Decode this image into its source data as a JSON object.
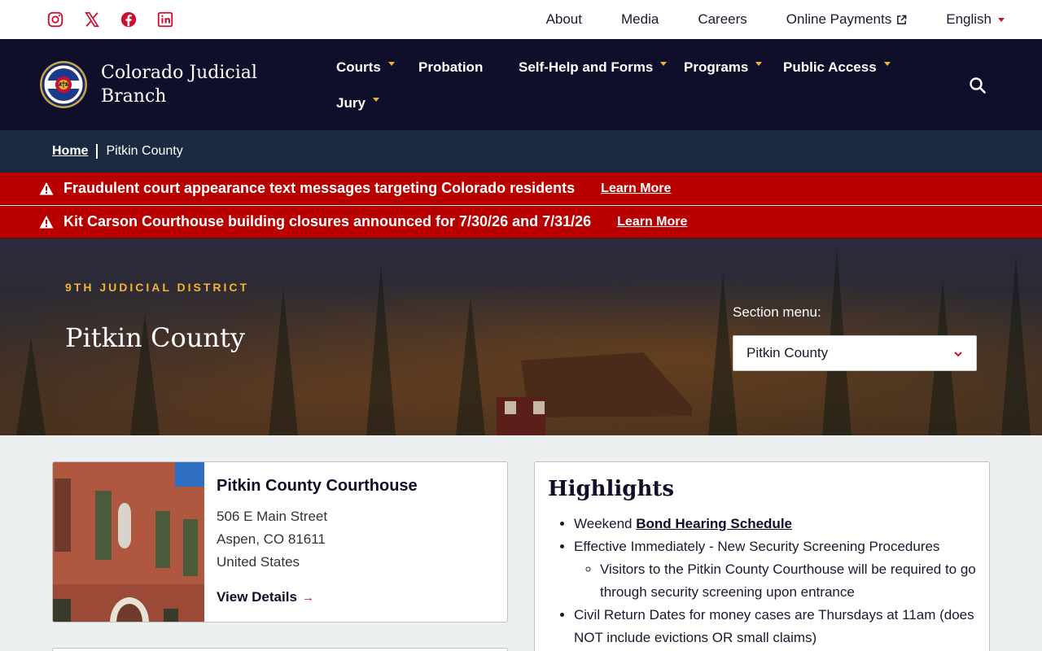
{
  "utility": {
    "social": [
      "instagram-icon",
      "x-icon",
      "facebook-icon",
      "linkedin-icon"
    ],
    "links": {
      "about": "About",
      "media": "Media",
      "careers": "Careers",
      "payments": "Online Payments",
      "language": "English"
    }
  },
  "header": {
    "brand_line1": "Colorado Judicial",
    "brand_line2": "Branch",
    "seal_text_top": "COLORADO",
    "seal_text_bottom": "COURTS",
    "nav": {
      "courts": "Courts",
      "probation": "Probation",
      "selfhelp": "Self-Help and Forms",
      "programs": "Programs",
      "public_access": "Public Access",
      "jury": "Jury"
    }
  },
  "breadcrumb": {
    "home": "Home",
    "current": "Pitkin County"
  },
  "alerts": [
    {
      "message": "Fraudulent court appearance text messages targeting Colorado residents",
      "link": "Learn More"
    },
    {
      "message": "Kit Carson Courthouse building closures announced for 7/30/26 and 7/31/26",
      "link": "Learn More"
    }
  ],
  "hero": {
    "eyebrow": "9TH JUDICIAL DISTRICT",
    "title": "Pitkin County",
    "section_menu_label": "Section menu:",
    "section_menu_value": "Pitkin County"
  },
  "courthouse": {
    "name": "Pitkin County Courthouse",
    "street": "506 E Main Street",
    "city": "Aspen, CO 81611",
    "country": "United States",
    "link": "View Details"
  },
  "highlights": {
    "title": "Highlights",
    "item1_prefix": "Weekend",
    "item1_link": "Bond Hearing Schedule",
    "item2": "Effective Immediately - New Security Screening Procedures",
    "item2_sub": "Visitors to the Pitkin County Courthouse will be required to go through security screening upon entrance",
    "item3": "Civil Return Dates for money cases are Thursdays at 11am (does NOT include evictions OR small claims)"
  },
  "colors": {
    "navy": "#0f0e2b",
    "alert_red": "#b80000",
    "accent_gold": "#f2b434",
    "brand_red": "#c8102e"
  }
}
